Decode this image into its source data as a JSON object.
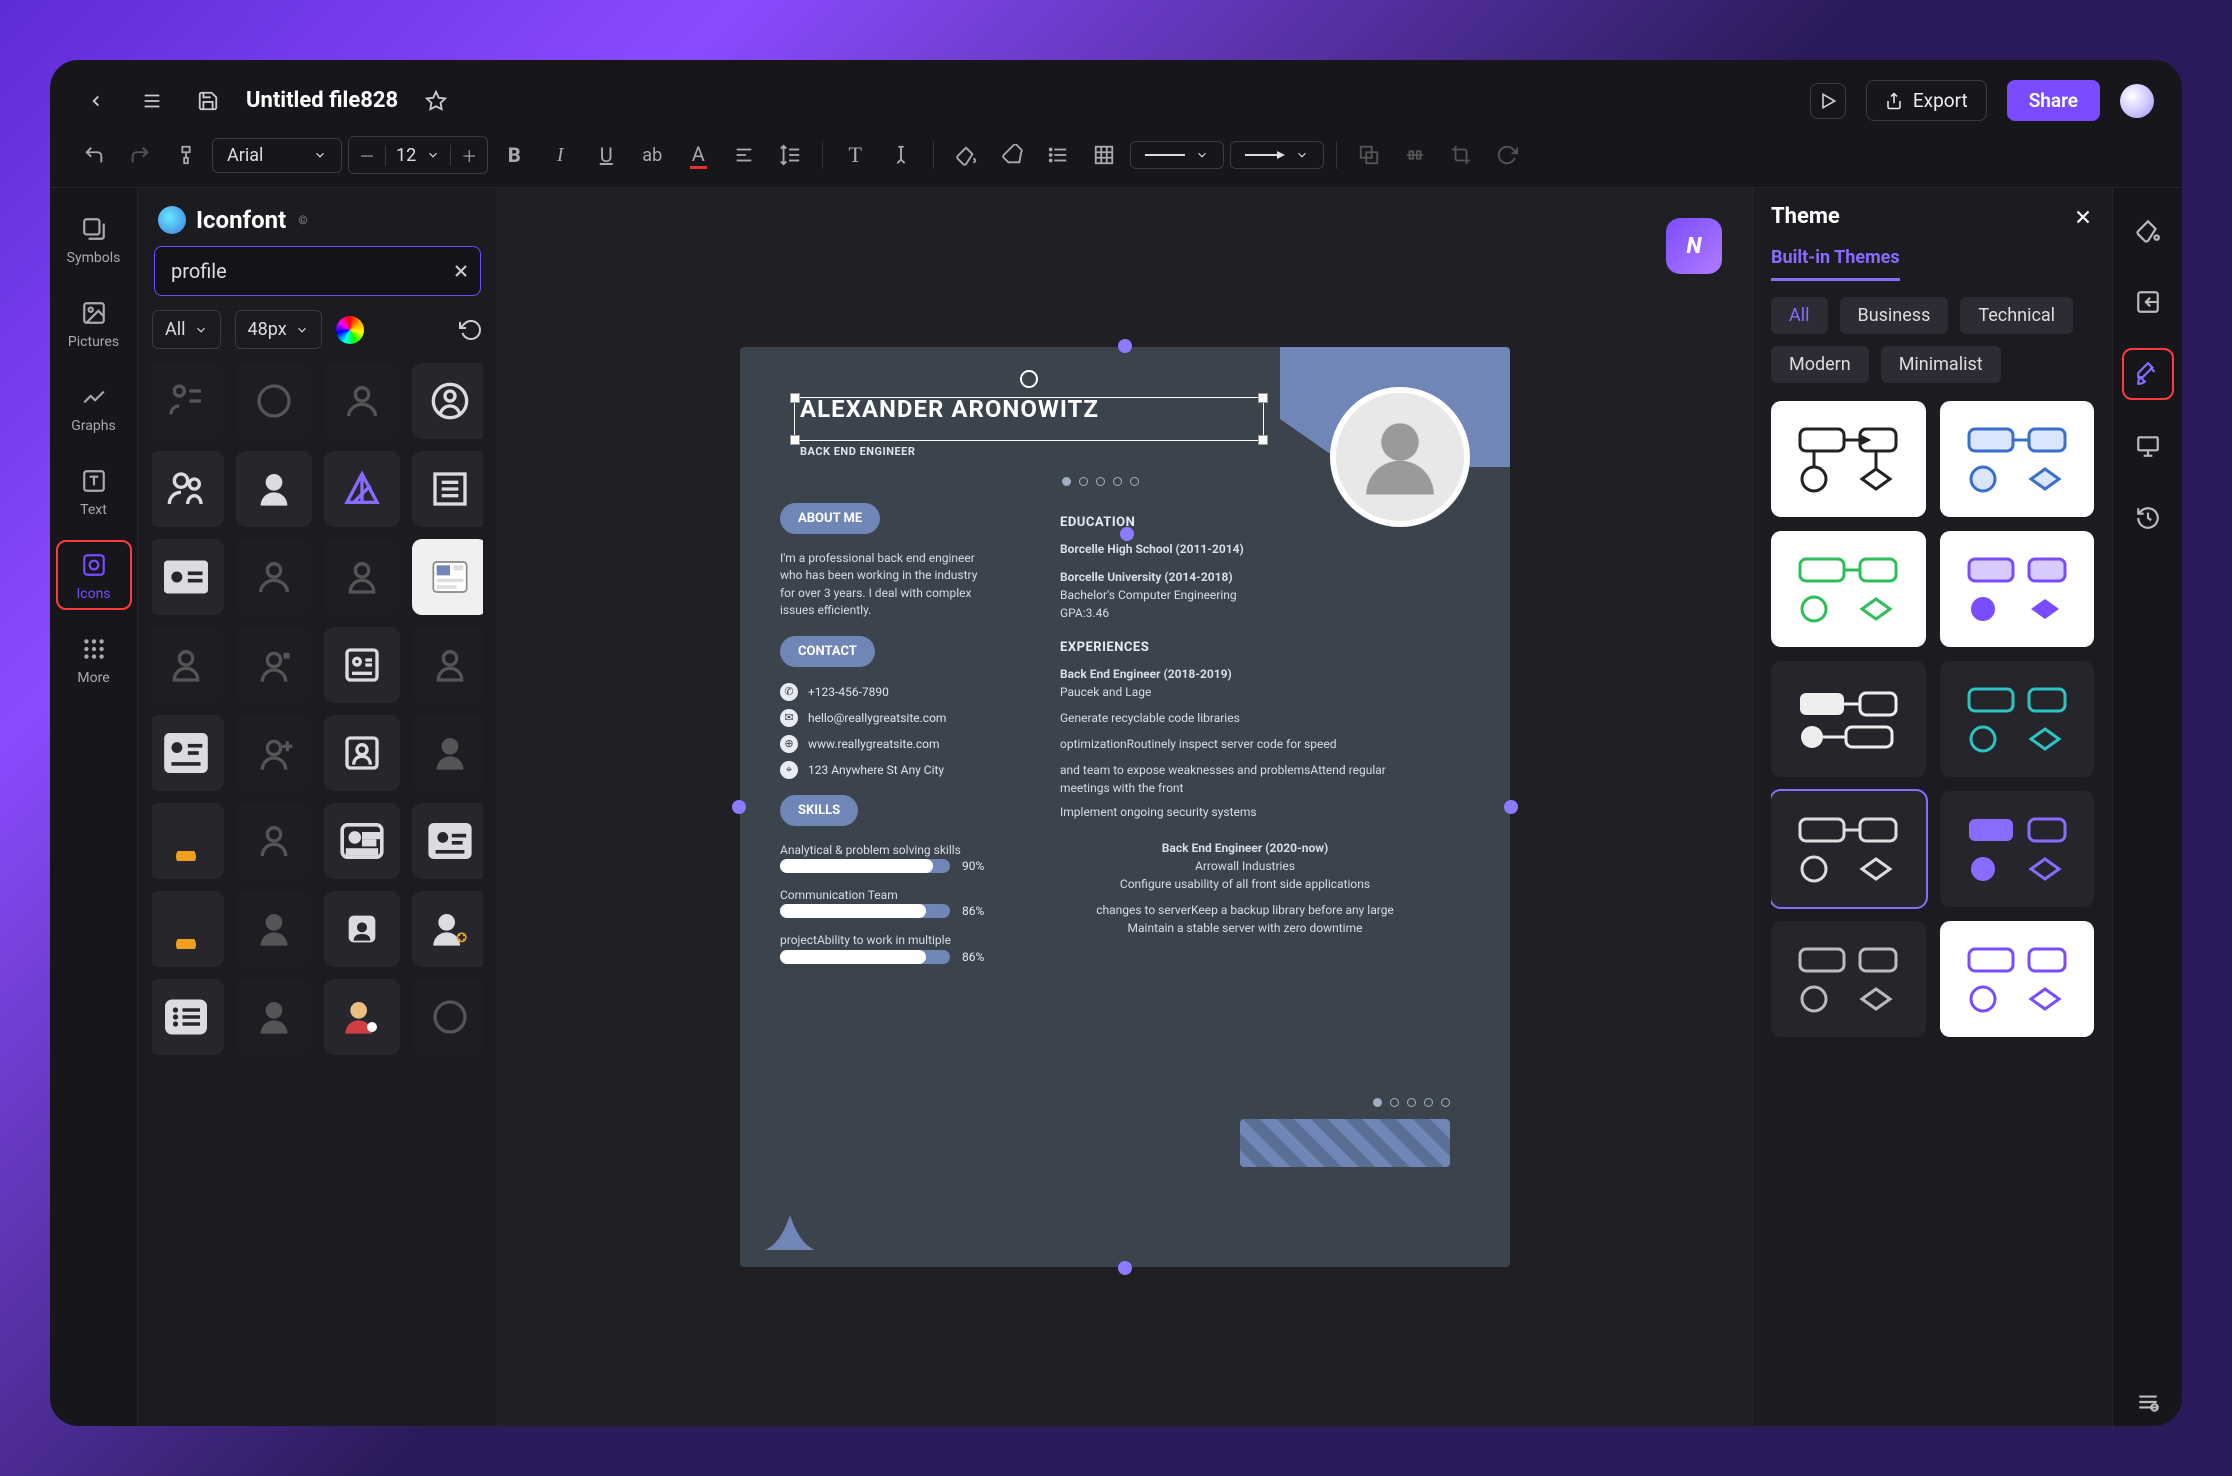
{
  "header": {
    "filename": "Untitled file828",
    "export_label": "Export",
    "share_label": "Share"
  },
  "toolbar": {
    "font": "Arial",
    "font_size": "12"
  },
  "leftrail": {
    "items": [
      {
        "label": "Symbols"
      },
      {
        "label": "Pictures"
      },
      {
        "label": "Graphs"
      },
      {
        "label": "Text"
      },
      {
        "label": "Icons"
      },
      {
        "label": "More"
      }
    ]
  },
  "iconpanel": {
    "title": "Iconfont",
    "search_value": "profile",
    "filter_all": "All",
    "filter_size": "48px"
  },
  "theme": {
    "title": "Theme",
    "tab": "Built-in Themes",
    "chips": [
      "All",
      "Business",
      "Technical",
      "Modern",
      "Minimalist"
    ]
  },
  "doc": {
    "name": "ALEXANDER ARONOWITZ",
    "role": "BACK END ENGINEER",
    "about_label": "ABOUT ME",
    "about_text": "I'm a professional back end engineer who has been working in the industry for over 3 years. I deal with complex issues efficiently.",
    "contact_label": "CONTACT",
    "phone": "+123-456-7890",
    "email": "hello@reallygreatsite.com",
    "site": "www.reallygreatsite.com",
    "addr": "123 Anywhere St Any City",
    "skills_label": "SKILLS",
    "skill1": "Analytical & problem solving skills",
    "skill1_pct": "90%",
    "skill2": "Communication Team",
    "skill2_pct": "86%",
    "skill3": "projectAbility to work in multiple",
    "skill3_pct": "86%",
    "edu_label": "EDUCATION",
    "edu1": "Borcelle High School (2011-2014)",
    "edu2a": "Borcelle University (2014-2018)",
    "edu2b": "Bachelor's Computer Engineering",
    "edu2c": "GPA:3.46",
    "exp_label": "EXPERIENCES",
    "exp1a": "Back End Engineer (2018-2019)",
    "exp1b": "Paucek and Lage",
    "exp1c": "Generate recyclable code libraries",
    "exp1d": "optimizationRoutinely inspect server code for speed",
    "exp1e": "and team to expose weaknesses and problemsAttend regular meetings with the front",
    "exp1f": "Implement ongoing security systems",
    "exp2a": "Back End Engineer (2020-now)",
    "exp2b": "Arrowall Industries",
    "exp2c": "Configure usability of all front side applications",
    "exp2d": "changes to serverKeep a backup library before any large",
    "exp2e": "Maintain a stable server with zero downtime"
  }
}
